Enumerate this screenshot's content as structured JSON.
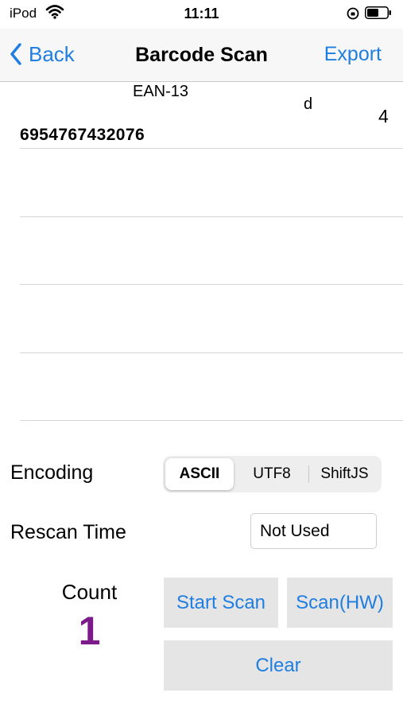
{
  "status_bar": {
    "carrier": "iPod",
    "time": "11:11"
  },
  "nav": {
    "back_label": "Back",
    "title": "Barcode Scan",
    "export_label": "Export"
  },
  "results": [
    {
      "type": "EAN-13",
      "extra": "d",
      "length": "4",
      "code": "6954767432076"
    }
  ],
  "encoding": {
    "label": "Encoding",
    "options": [
      "ASCII",
      "UTF8",
      "ShiftJS"
    ],
    "selected": "ASCII"
  },
  "rescan": {
    "label": "Rescan Time",
    "value": "Not Used"
  },
  "count": {
    "label": "Count",
    "value": "1"
  },
  "buttons": {
    "start_scan": "Start Scan",
    "scan_hw": "Scan(HW)",
    "clear": "Clear"
  },
  "colors": {
    "accent": "#1f7ee0",
    "count": "#7d1a8a",
    "button_bg": "#e5e5e5"
  }
}
